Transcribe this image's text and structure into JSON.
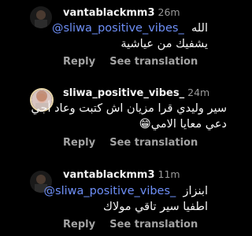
{
  "comments": [
    {
      "username": "vantablackmm3",
      "time": "26m",
      "mention": "@sliwa_positive_vibes_",
      "line1_text": "الله",
      "line2": "يشفيك من عياشية",
      "reply": "Reply",
      "see_translation": "See translation"
    },
    {
      "username": "sliwa_positive_vibes_",
      "time": "24m",
      "line1": "سير وليدي قرا مزيان اش كتبت وعاد أجي",
      "line2": "دعي معايا الامي😁",
      "reply": "Reply",
      "see_translation": "See translation"
    },
    {
      "username": "vantablackmm3",
      "time": "11m",
      "mention": "@sliwa_positive_vibes_",
      "line1_text": "ابنزاز",
      "line2": "اطفيا سير تاقي مولاك",
      "reply": "Reply",
      "see_translation": "See translation"
    }
  ]
}
